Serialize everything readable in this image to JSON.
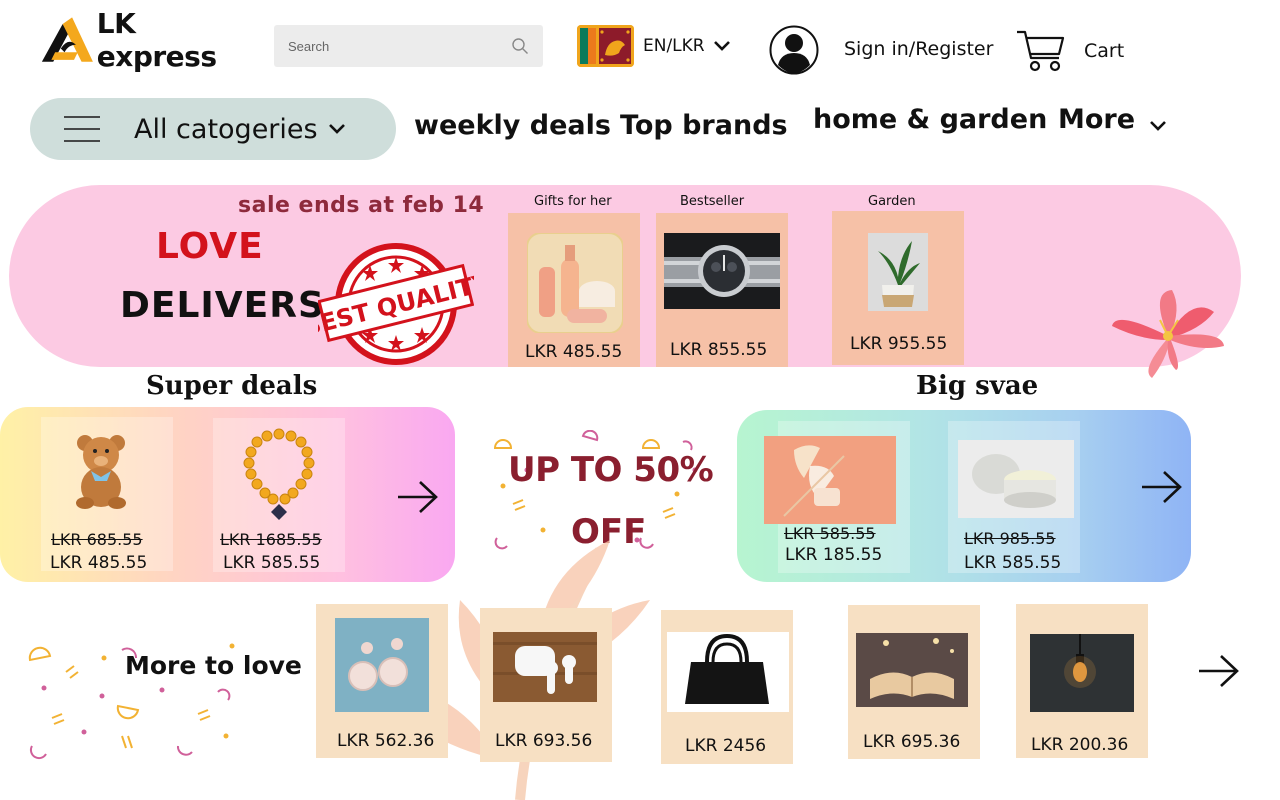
{
  "brand": {
    "name": "LK express",
    "accent": "#f4a81d"
  },
  "search": {
    "placeholder": "Search",
    "icon": "search-icon"
  },
  "locale": {
    "label": "EN/LKR",
    "flag": "sri-lanka-flag"
  },
  "account": {
    "signin_label": "Sign in/Register",
    "icon": "user-avatar-icon"
  },
  "cart": {
    "label": "Cart",
    "icon": "cart-icon"
  },
  "nav": {
    "all_categories": "All catogeries",
    "links": [
      "weekly deals",
      "Top brands",
      "home & garden"
    ],
    "more": "More"
  },
  "banner": {
    "sale_text": "sale ends at feb 14",
    "headline_1": "LOVE",
    "headline_2": "DELIVERS",
    "stamp_line": "BEST QUALITY",
    "categories": [
      {
        "label": "Gifts for her",
        "price": "LKR 485.55"
      },
      {
        "label": "Bestseller",
        "price": "LKR 855.55"
      },
      {
        "label": "Garden",
        "price": "LKR 955.55"
      }
    ]
  },
  "super_deals": {
    "title": "Super deals",
    "items": [
      {
        "old_price": "LKR 685.55",
        "new_price": "LKR 485.55"
      },
      {
        "old_price": "LKR 1685.55",
        "new_price": "LKR 585.55"
      }
    ]
  },
  "promo": {
    "line_1": "UP TO 50%",
    "line_2": "OFF"
  },
  "big_save": {
    "title": "Big svae",
    "items": [
      {
        "old_price": "LKR 585.55",
        "new_price": "LKR 185.55"
      },
      {
        "old_price": "LKR 985.55",
        "new_price": "LKR 585.55"
      }
    ]
  },
  "more_to_love": {
    "title": "More to love",
    "items": [
      {
        "price": "LKR 562.36"
      },
      {
        "price": "LKR 693.56"
      },
      {
        "price": "LKR 2456"
      },
      {
        "price": "LKR 695.36"
      },
      {
        "price": "LKR 200.36"
      }
    ]
  }
}
